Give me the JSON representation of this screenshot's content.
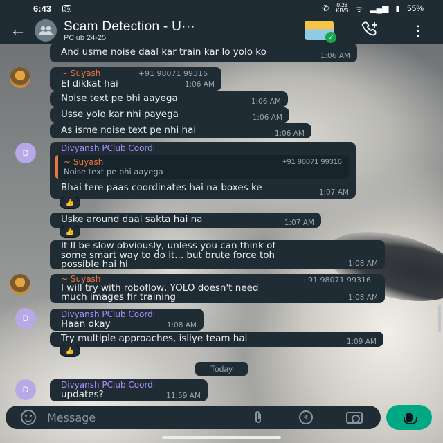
{
  "status_bar": {
    "time": "6:43",
    "net_speed_value": "0.28",
    "net_speed_unit": "KB/S",
    "battery": "55%"
  },
  "header": {
    "back_glyph": "←",
    "title": "Scam Detection - U···",
    "subtitle": "PClub 24-25"
  },
  "messages": [
    {
      "text": "And usme noise daal kar train kar lo yolo ko",
      "time": "1:06 AM"
    },
    {
      "sender": "~ Suyash",
      "phone": "+91 98071 99316",
      "text": "El dikkat hai",
      "time": "1:06 AM"
    },
    {
      "text": "Noise text pe bhi aayega",
      "time": "1:06 AM"
    },
    {
      "text": "Usse yolo kar nhi payega",
      "time": "1:06 AM"
    },
    {
      "text": "As isme noise text pe nhi hai",
      "time": "1:06 AM"
    },
    {
      "sender": "Divyansh PClub Coordi",
      "text": "Bhai tere paas coordinates hai na boxes ke",
      "time": "1:07 AM",
      "quote": {
        "sender": "~ Suyash",
        "phone": "+91 98071 99316",
        "text": "Noise text pe bhi aayega"
      }
    },
    {
      "text": "Uske around daal sakta hai na",
      "time": "1:07 AM"
    },
    {
      "text_lines": [
        "It ll be slow obviously, unless you can think of",
        "some smart way to do it... but brute force toh",
        "possible hai hi"
      ],
      "time": "1:08 AM"
    },
    {
      "sender": "~ Suyash",
      "phone": "+91 98071 99316",
      "text_lines": [
        "I will try with roboflow, YOLO doesn't need",
        "much images fir training"
      ],
      "time": "1:08 AM"
    },
    {
      "sender": "Divyansh PClub Coordi",
      "text": "Haan okay",
      "time": "1:08 AM"
    },
    {
      "text": "Try multiple approaches, isliye team hai",
      "time": "1:09 AM"
    },
    {
      "sender": "Divyansh PClub Coordi",
      "text": "updates?",
      "time": "11:59 AM"
    }
  ],
  "avatars": {
    "divyansh_initial": "D"
  },
  "reaction_emoji": "👍",
  "day_separator": "Today",
  "composer": {
    "placeholder": "Message",
    "rupee_glyph": "₹"
  },
  "icons": [
    "back-arrow-icon",
    "group-icon",
    "wallet-icon",
    "add-call-icon",
    "more-options-icon",
    "emoji-icon",
    "attach-icon",
    "rupee-icon",
    "camera-icon",
    "mic-icon"
  ]
}
